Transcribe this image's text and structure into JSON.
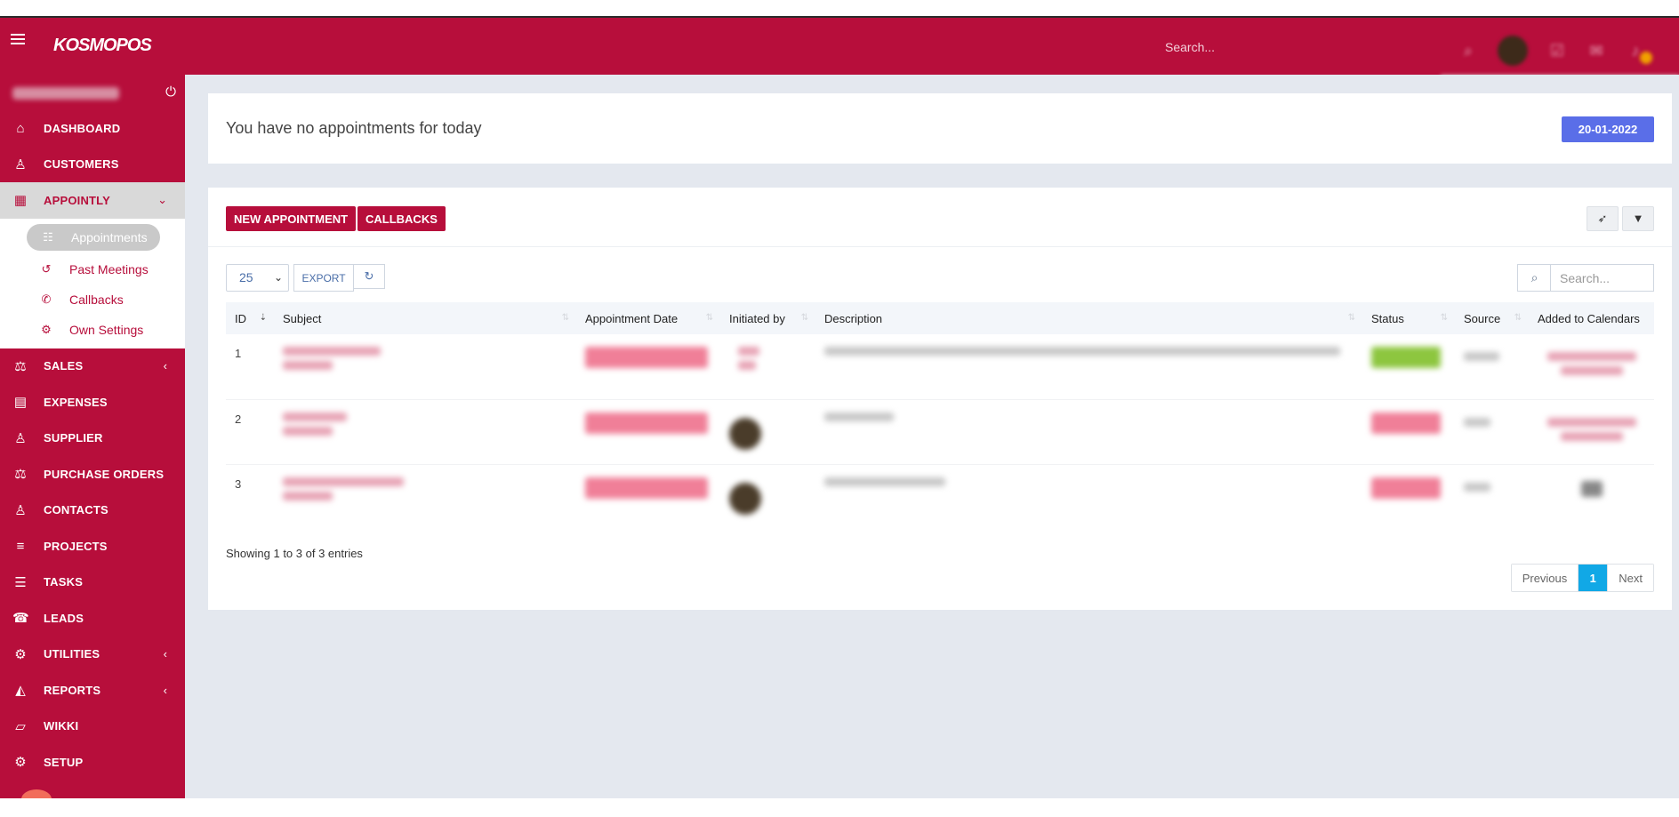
{
  "header": {
    "logo": "KOSMOPOS",
    "search_placeholder": "Search..."
  },
  "sidebar": {
    "items": [
      {
        "label": "DASHBOARD",
        "icon": "home-icon",
        "glyph": "⌂",
        "chev": ""
      },
      {
        "label": "CUSTOMERS",
        "icon": "user-icon",
        "glyph": "♙",
        "chev": ""
      },
      {
        "label": "APPOINTLY",
        "icon": "calendar-icon",
        "glyph": "▦",
        "chev": "⌄"
      },
      {
        "label": "SALES",
        "icon": "balance-icon",
        "glyph": "⚖",
        "chev": "‹"
      },
      {
        "label": "EXPENSES",
        "icon": "document-icon",
        "glyph": "▤",
        "chev": ""
      },
      {
        "label": "SUPPLIER",
        "icon": "user-icon",
        "glyph": "♙",
        "chev": ""
      },
      {
        "label": "PURCHASE ORDERS",
        "icon": "balance-icon",
        "glyph": "⚖",
        "chev": ""
      },
      {
        "label": "CONTACTS",
        "icon": "user-icon",
        "glyph": "♙",
        "chev": ""
      },
      {
        "label": "PROJECTS",
        "icon": "bars-icon",
        "glyph": "≡",
        "chev": ""
      },
      {
        "label": "TASKS",
        "icon": "tasks-icon",
        "glyph": "☰",
        "chev": ""
      },
      {
        "label": "LEADS",
        "icon": "phone-icon",
        "glyph": "☎",
        "chev": ""
      },
      {
        "label": "UTILITIES",
        "icon": "cogs-icon",
        "glyph": "⚙",
        "chev": "‹"
      },
      {
        "label": "REPORTS",
        "icon": "area-chart-icon",
        "glyph": "◭",
        "chev": "‹"
      },
      {
        "label": "WIKKI",
        "icon": "folder-open-icon",
        "glyph": "▱",
        "chev": ""
      },
      {
        "label": "SETUP",
        "icon": "gear-icon",
        "glyph": "⚙",
        "chev": ""
      }
    ],
    "submenu": [
      {
        "label": "Appointments",
        "icon": "list-icon",
        "glyph": "☷"
      },
      {
        "label": "Past Meetings",
        "icon": "history-icon",
        "glyph": "↺"
      },
      {
        "label": "Callbacks",
        "icon": "phone-icon",
        "glyph": "✆"
      },
      {
        "label": "Own Settings",
        "icon": "gear-icon",
        "glyph": "⚙"
      }
    ]
  },
  "today": {
    "message": "You have no appointments for today",
    "date": "20-01-2022"
  },
  "toolbar": {
    "new_appointment": "NEW APPOINTMENT",
    "callbacks": "CALLBACKS"
  },
  "table_controls": {
    "page_size": "25",
    "export": "EXPORT",
    "search_placeholder": "Search..."
  },
  "table": {
    "columns": [
      "ID",
      "Subject",
      "Appointment Date",
      "Initiated by",
      "Description",
      "Status",
      "Source",
      "Added to Calendars"
    ],
    "rows": [
      {
        "id": "1"
      },
      {
        "id": "2"
      },
      {
        "id": "3"
      }
    ]
  },
  "footer": {
    "info": "Showing 1 to 3 of 3 entries",
    "previous": "Previous",
    "current_page": "1",
    "next": "Next"
  },
  "colors": {
    "brand": "#b70e3b",
    "date_button": "#5a6ee8",
    "pager_active": "#11a8e6"
  }
}
